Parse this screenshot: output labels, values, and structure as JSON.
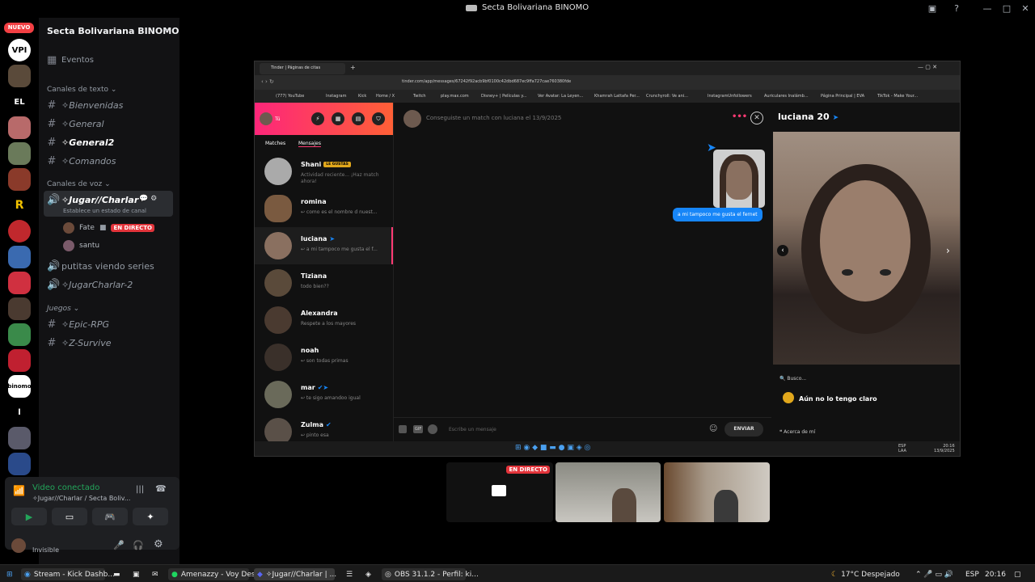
{
  "window_title": "Secta Bolivariana BINOMO",
  "titlebar_logo": "Binomo",
  "server_rail": {
    "nuevo_badge": "NUEVO",
    "text_servers": [
      "VPI",
      "EL",
      "l"
    ],
    "binomo_label": "binomo"
  },
  "sidebar": {
    "server_name": "Secta Bolivariana BINOMO",
    "eventos": "Eventos",
    "text_category": "Canales de texto",
    "text_channels": [
      "✧Bienvenidas",
      "✧General",
      "✧General2",
      "✧Comandos"
    ],
    "voice_category": "Canales de voz",
    "active_voice": "✧Jugar//Charlar",
    "active_voice_sub": "Establece un estado de canal",
    "voice_users": [
      {
        "name": "Fate",
        "live": "EN DIRECTO"
      },
      {
        "name": "santu"
      }
    ],
    "voice_channels": [
      "putitas viendo series",
      "✧JugarCharlar-2"
    ],
    "games_category": "Juegos",
    "games_channels": [
      "✧Epic-RPG",
      "✧Z-Survive"
    ]
  },
  "voice_panel": {
    "status": "Video conectado",
    "location": "✧Jugar//Charlar / Secta Boliv...",
    "user_status": "Invisible"
  },
  "browser": {
    "tab_title": "Tinder | Páginas de citas",
    "url": "tinder.com/app/messages/67242f92acb9bf0100c42dbd687ec9ffa727cae760380fde",
    "bookmarks": [
      "(777) YouTube",
      "Instagram",
      "Kick",
      "Home / X",
      "Twitch",
      "play.max.com",
      "Disney+ | Películas y...",
      "Ver Avatar: La Leyen...",
      "Khamrah Lattafa Per...",
      "Crunchyroll: Ve ani...",
      "InstagramUnfollowers",
      "Auriculares Inalámb...",
      "Página Principal | EVA",
      "TikTok - Make Your..."
    ]
  },
  "tinder": {
    "me": "Tú",
    "tabs": [
      "Matches",
      "Mensajes"
    ],
    "conversations": [
      {
        "name": "Shani",
        "badge": "LE GUSTAS",
        "msg": "Actividad reciente... ¡Haz match",
        "msg2": "ahora!"
      },
      {
        "name": "romina",
        "msg": "↩ como es el nombre d nuest..."
      },
      {
        "name": "luciana",
        "msg": "↩ a mi tampoco me gusta el f..."
      },
      {
        "name": "Tiziana",
        "msg": "todo bien??"
      },
      {
        "name": "Alexandra",
        "msg": "Respete a los mayores"
      },
      {
        "name": "noah",
        "msg": "↩ son todas primas"
      },
      {
        "name": "mar",
        "msg": "↩ te sigo amandoo igual"
      },
      {
        "name": "Zulma",
        "msg": "↩ pinto esa"
      }
    ],
    "match_header": "Conseguiste un match con luciana el 13/9/2025",
    "bubble": "a mi tampoco me gusta el fernet",
    "composer_placeholder": "Escribe un mensaje",
    "send": "ENVIAR",
    "gif": "GIF",
    "profile_name": "luciana 20",
    "busco": "Busco...",
    "busco_value": "Aún no lo tengo claro",
    "acerca": "Acerca de mí"
  },
  "inner_taskbar": {
    "lang": "ESP",
    "lang2": "LAA",
    "time": "20:16",
    "date": "13/9/2025"
  },
  "video_tiles": {
    "live": "EN DIRECTO"
  },
  "taskbar": {
    "items": [
      "Stream - Kick Dashb...",
      "Amenazzy - Voy Des...",
      "✧Jugar//Charlar | ...",
      "OBS 31.1.2 - Perfil: ki..."
    ],
    "weather": "17°C  Despejado",
    "lang": "ESP",
    "time": "20:16"
  }
}
